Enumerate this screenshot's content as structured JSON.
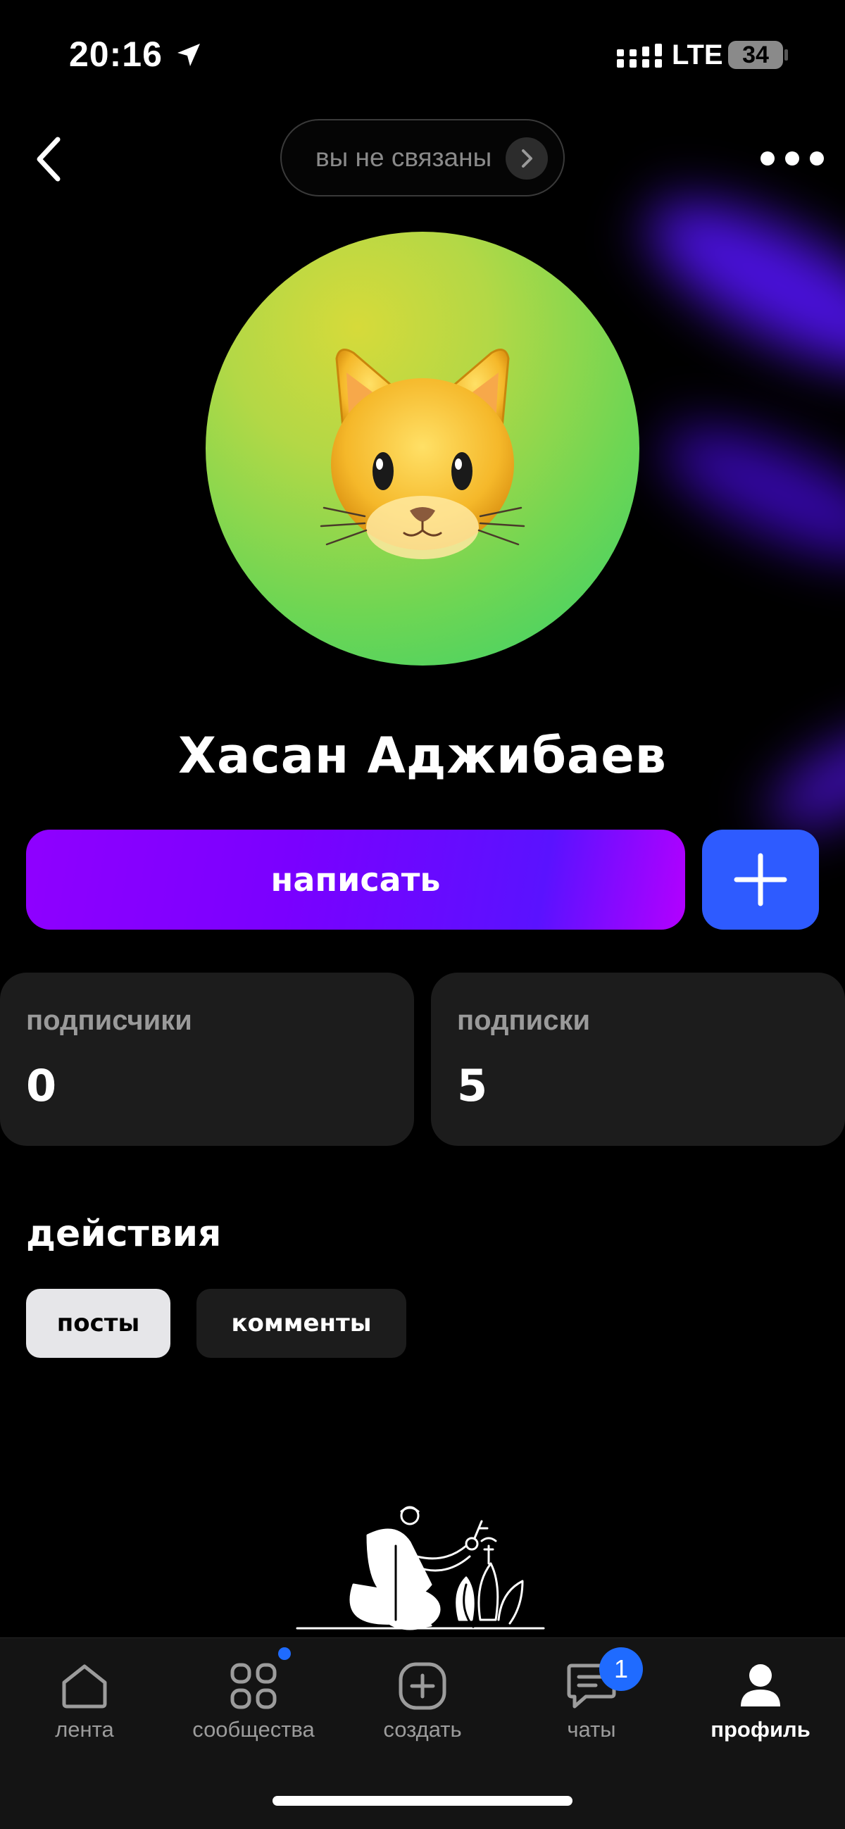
{
  "status_bar": {
    "time": "20:16",
    "network": "LTE",
    "battery": "34",
    "icons": [
      "location-arrow-icon",
      "signal-icon",
      "battery-icon"
    ]
  },
  "header": {
    "back_icon": "chevron-left-icon",
    "connection_status": "вы не связаны",
    "connection_arrow_icon": "chevron-right-icon",
    "more_icon": "ellipsis-icon"
  },
  "profile": {
    "avatar_icon": "cat-face-icon",
    "name": "Хасан Аджибаев"
  },
  "actions": {
    "write_label": "написать",
    "follow_icon": "plus-icon"
  },
  "stats": {
    "followers": {
      "label": "подписчики",
      "value": "0"
    },
    "following": {
      "label": "подписки",
      "value": "5"
    }
  },
  "activity": {
    "title": "действия",
    "chips": [
      "посты",
      "комменты"
    ],
    "selected": "посты"
  },
  "tab_bar": {
    "tabs": [
      {
        "label": "лента",
        "icon": "home-icon"
      },
      {
        "label": "сообщества",
        "icon": "grid-icon"
      },
      {
        "label": "создать",
        "icon": "plus-square-icon"
      },
      {
        "label": "чаты",
        "icon": "chat-icon"
      },
      {
        "label": "профиль",
        "icon": "person-icon"
      }
    ],
    "active": "профиль",
    "chats_badge": "1"
  },
  "colors": {
    "background": "#000000",
    "write_button": "#8f00ff",
    "follow_button": "#2e5bff",
    "card": "#1c1c1c",
    "badge": "#1f6bff"
  }
}
